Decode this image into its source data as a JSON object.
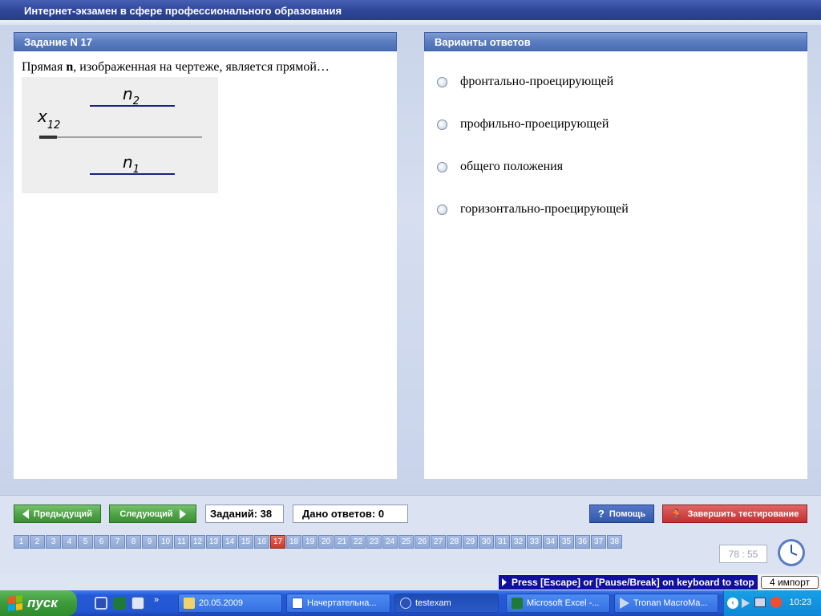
{
  "window": {
    "title": "Интернет-экзамен в сфере профессионального образования"
  },
  "task": {
    "header": "Задание N 17",
    "question_prefix": "Прямая ",
    "question_var": "n",
    "question_suffix": ", изображенная на чертеже, является прямой…",
    "drawing": {
      "top_label": "n",
      "top_sub": "2",
      "axis_label": "x",
      "axis_sub": "12",
      "bottom_label": "n",
      "bottom_sub": "1"
    }
  },
  "answers": {
    "header": "Варианты ответов",
    "options": [
      "фронтально-проецирующей",
      "профильно-проецирующей",
      "общего положения",
      "горизонтально-проецирующей"
    ]
  },
  "controls": {
    "prev_label": "Предыдущий",
    "next_label": "Следующий",
    "tasks_count": "Заданий: 38",
    "answers_given": "Дано ответов: 0",
    "help_label": "Помощь",
    "finish_label": "Завершить тестирование",
    "question_numbers": [
      "1",
      "2",
      "3",
      "4",
      "5",
      "6",
      "7",
      "8",
      "9",
      "10",
      "11",
      "12",
      "13",
      "14",
      "15",
      "16",
      "17",
      "18",
      "19",
      "20",
      "21",
      "22",
      "23",
      "24",
      "25",
      "26",
      "27",
      "28",
      "29",
      "30",
      "31",
      "32",
      "33",
      "34",
      "35",
      "36",
      "37",
      "38"
    ],
    "current_question": "17",
    "timer": "78 : 55"
  },
  "hint": {
    "text": "Press [Escape] or [Pause/Break] on keyboard to stop",
    "chip": "4 импорт"
  },
  "taskbar": {
    "start_label": "пуск",
    "tasks": [
      {
        "label": "20.05.2009",
        "icon": "folder-icon"
      },
      {
        "label": "Начертательна...",
        "icon": "word-icon"
      },
      {
        "label": "testexam",
        "icon": "app-icon"
      },
      {
        "label": "Microsoft Excel -...",
        "icon": "excel-icon"
      },
      {
        "label": "Tronan MacroMa...",
        "icon": "play-icon"
      }
    ],
    "clock": "10:23"
  }
}
